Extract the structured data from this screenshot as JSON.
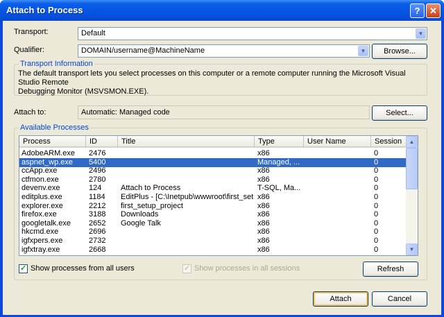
{
  "window": {
    "title": "Attach to Process",
    "help_glyph": "?",
    "close_glyph": "✕"
  },
  "transport": {
    "label": "Transport:",
    "value": "Default"
  },
  "qualifier": {
    "label": "Qualifier:",
    "value": "DOMAIN/username@MachineName",
    "browse_label": "Browse..."
  },
  "transport_info": {
    "title": "Transport Information",
    "text_line1": "The default transport lets you select processes on this computer or a remote computer running the Microsoft Visual Studio Remote",
    "text_line2": "Debugging Monitor (MSVSMON.EXE)."
  },
  "attach_to": {
    "label": "Attach to:",
    "value": "Automatic: Managed code",
    "select_label": "Select..."
  },
  "processes": {
    "title": "Available Processes",
    "columns": [
      "Process",
      "ID",
      "Title",
      "Type",
      "User Name",
      "Session"
    ],
    "rows": [
      {
        "process": "AdobeARM.exe",
        "id": "2476",
        "title": "",
        "type": "x86",
        "user": "",
        "session": "0"
      },
      {
        "process": "aspnet_wp.exe",
        "id": "5400",
        "title": "",
        "type": "Managed, ...",
        "user": "",
        "session": "0"
      },
      {
        "process": "ccApp.exe",
        "id": "2496",
        "title": "",
        "type": "x86",
        "user": "",
        "session": "0"
      },
      {
        "process": "ctfmon.exe",
        "id": "2780",
        "title": "",
        "type": "x86",
        "user": "",
        "session": "0"
      },
      {
        "process": "devenv.exe",
        "id": "124",
        "title": "Attach to Process",
        "type": "T-SQL, Ma...",
        "user": "",
        "session": "0"
      },
      {
        "process": "editplus.exe",
        "id": "1184",
        "title": "EditPlus - [C:\\Inetpub\\wwwroot\\first_setu...",
        "type": "x86",
        "user": "",
        "session": "0"
      },
      {
        "process": "explorer.exe",
        "id": "2212",
        "title": "first_setup_project",
        "type": "x86",
        "user": "",
        "session": "0"
      },
      {
        "process": "firefox.exe",
        "id": "3188",
        "title": "Downloads",
        "type": "x86",
        "user": "",
        "session": "0"
      },
      {
        "process": "googletalk.exe",
        "id": "2652",
        "title": "Google Talk",
        "type": "x86",
        "user": "",
        "session": "0"
      },
      {
        "process": "hkcmd.exe",
        "id": "2696",
        "title": "",
        "type": "x86",
        "user": "",
        "session": "0"
      },
      {
        "process": "igfxpers.exe",
        "id": "2732",
        "title": "",
        "type": "x86",
        "user": "",
        "session": "0"
      },
      {
        "process": "igfxtray.exe",
        "id": "2668",
        "title": "",
        "type": "x86",
        "user": "",
        "session": "0"
      }
    ],
    "selected_index": 1,
    "show_all_users_label": "Show processes from all users",
    "show_all_sessions_label": "Show processes in all sessions",
    "refresh_label": "Refresh"
  },
  "footer": {
    "attach_label": "Attach",
    "cancel_label": "Cancel"
  },
  "icons": {
    "dropdown": "chevron-down-icon",
    "scroll_up": "arrow-up-icon",
    "scroll_down": "arrow-down-icon",
    "check": "check-icon"
  }
}
